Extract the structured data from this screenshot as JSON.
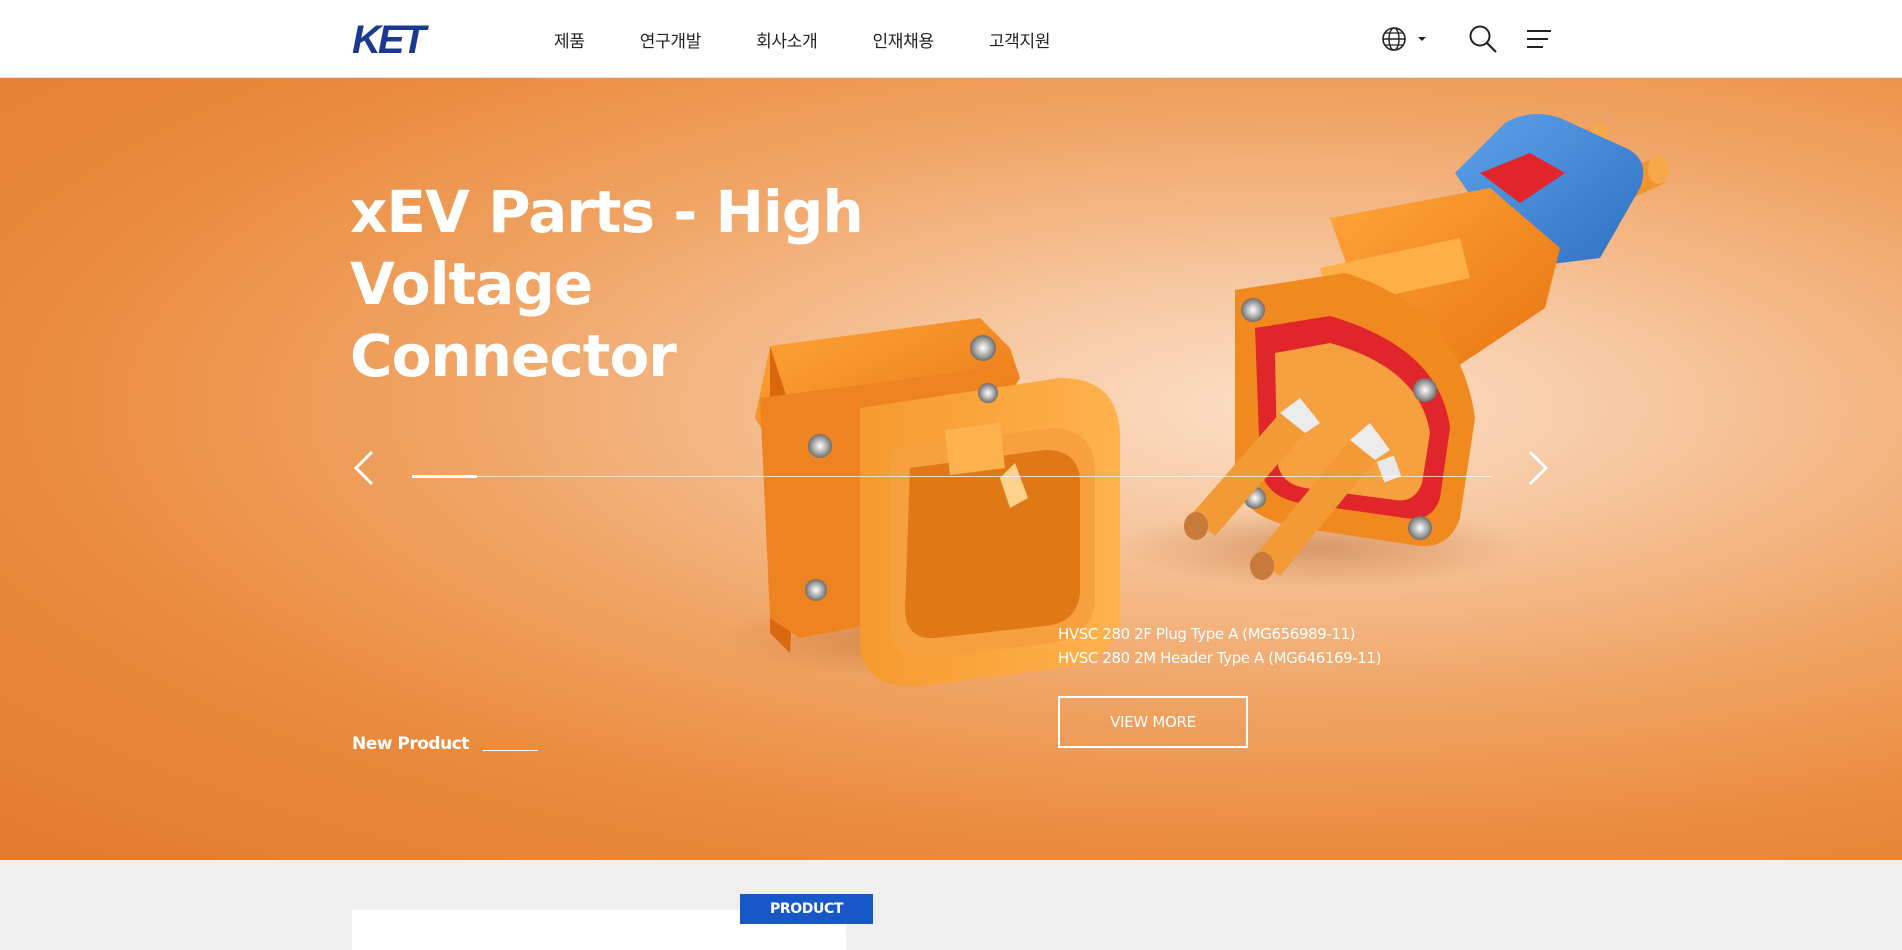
{
  "header": {
    "logo_text": "KET",
    "nav": [
      "제품",
      "연구개발",
      "회사소개",
      "인재채용",
      "고객지원"
    ],
    "icons": {
      "language": "globe-icon",
      "language_toggle": "caret-down-icon",
      "search": "search-icon",
      "menu": "hamburger-icon"
    }
  },
  "hero": {
    "title_line1": "xEV Parts - High Voltage",
    "title_line2": "Connector",
    "caption_line1": "HVSC 280 2F Plug Type A (MG656989-11)",
    "caption_line2": "HVSC 280 2M Header Type A (MG646169-11)",
    "view_more": "VIEW MORE",
    "tag": "New Product",
    "slider_progress": 0.06,
    "icons": {
      "prev": "chevron-left-icon",
      "next": "chevron-right-icon"
    }
  },
  "section": {
    "badge": "PRODUCT"
  },
  "colors": {
    "brand_blue": "#1a3a8f",
    "badge_blue": "#1758c9",
    "hero_orange": "#e37a2c",
    "connector_orange": "#f28c1e",
    "connector_blue": "#3d86d6"
  }
}
